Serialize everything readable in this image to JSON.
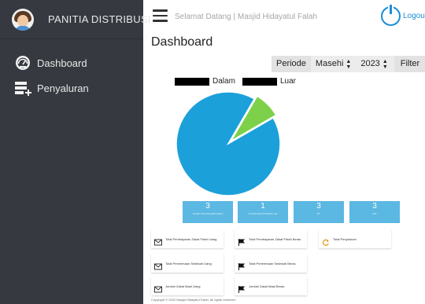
{
  "sidebar": {
    "brand": "PANITIA DISTRIBUSI",
    "items": [
      {
        "label": "Dashboard",
        "icon": "speedometer-icon"
      },
      {
        "label": "Penyaluran",
        "icon": "list-add-icon"
      }
    ]
  },
  "topbar": {
    "welcome": "Selamat Datang | Masjid Hidayatul Falah",
    "logout_label": "Logou"
  },
  "page_title": "Dashboard",
  "filter": {
    "periode_label": "Periode",
    "calendar_value": "Masehi",
    "year_value": "2023",
    "filter_label": "Filter"
  },
  "chart_data": {
    "type": "pie",
    "series": [
      {
        "name": "Dalam",
        "value": 91.7,
        "color": "#1ca0da"
      },
      {
        "name": "Luar",
        "value": 8.3,
        "color": "#7dd14a"
      }
    ]
  },
  "stats": [
    {
      "value": "3",
      "caption": "Jumlah Data Mustahik Dalam"
    },
    {
      "value": "1",
      "caption": "Jumlah Data Mustahik Luar"
    },
    {
      "value": "3",
      "caption": "RT"
    },
    {
      "value": "3",
      "caption": "RW"
    }
  ],
  "cards": [
    {
      "label": "Total Pembayaran Zakat Fitrah Uang",
      "icon": "envelope-icon"
    },
    {
      "label": "Total Pembayaran Zakat Fitrah Beras",
      "icon": "flag-icon"
    },
    {
      "label": "Total Penyaluran",
      "icon": "refresh-icon"
    },
    {
      "label": "Total Penerimaan Sedekah Uang",
      "icon": "envelope-icon"
    },
    {
      "label": "Total Penerimaan Sedekah Beras",
      "icon": "flag-icon"
    },
    {
      "label": "Jumlah Zakat Maal Uang",
      "icon": "envelope-icon"
    },
    {
      "label": "Jumlah Zakat Maal Beras",
      "icon": "flag-icon"
    }
  ],
  "footer": "Copyright © 2022 Masjid Hidayatul Falah. All rights reserved."
}
